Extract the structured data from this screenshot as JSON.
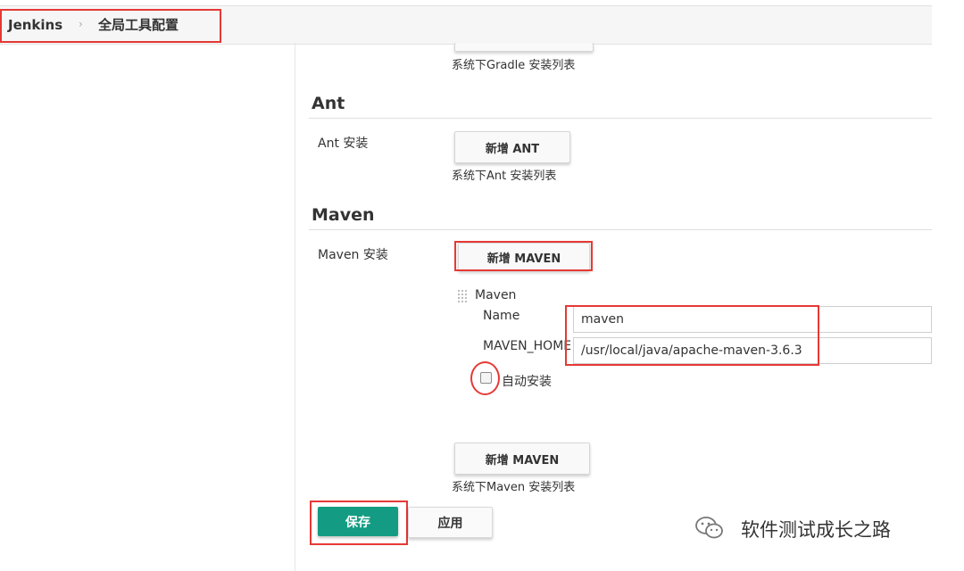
{
  "breadcrumb": {
    "root": "Jenkins",
    "separator": "›",
    "current": "全局工具配置"
  },
  "gradle": {
    "description": "系统下Gradle 安装列表"
  },
  "ant": {
    "title": "Ant",
    "install_label": "Ant 安装",
    "add_button": "新增 ANT",
    "description": "系统下Ant 安装列表"
  },
  "maven": {
    "title": "Maven",
    "install_label": "Maven 安装",
    "add_button_top": "新增 MAVEN",
    "installation": {
      "header": "Maven",
      "name_label": "Name",
      "name_value": "maven",
      "home_label": "MAVEN_HOME",
      "home_value": "/usr/local/java/apache-maven-3.6.3",
      "auto_install_label": "自动安装",
      "auto_install_checked": false
    },
    "add_button_bottom": "新增 MAVEN",
    "description": "系统下Maven 安装列表"
  },
  "actions": {
    "save": "保存",
    "apply": "应用"
  },
  "watermark": "软件测试成长之路",
  "colors": {
    "save_button": "#139c83",
    "highlight_red": "#e53935"
  }
}
